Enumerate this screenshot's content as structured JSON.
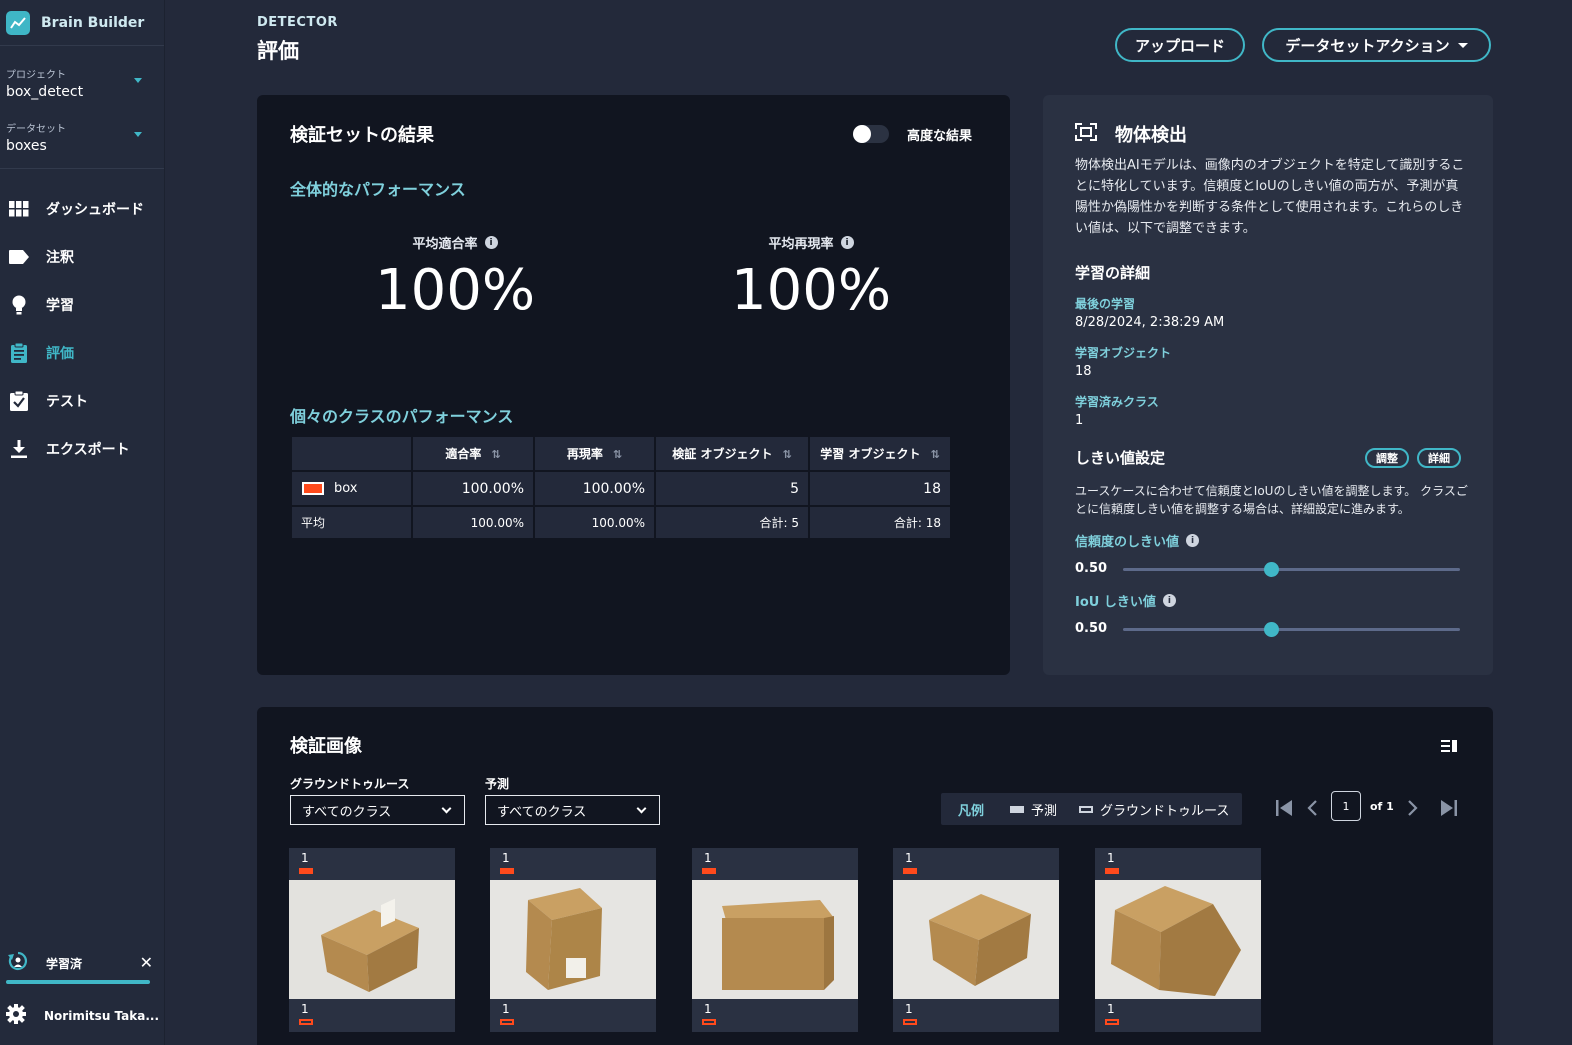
{
  "app": {
    "brand": "Brain Builder"
  },
  "sidebar": {
    "project": {
      "caption": "プロジェクト",
      "value": "box_detect"
    },
    "dataset": {
      "caption": "データセット",
      "value": "boxes"
    },
    "items": [
      {
        "label": "ダッシュボード",
        "icon": "grid-icon"
      },
      {
        "label": "注釈",
        "icon": "tag-icon"
      },
      {
        "label": "学習",
        "icon": "lightbulb-icon"
      },
      {
        "label": "評価",
        "icon": "clipboard-icon",
        "active": true
      },
      {
        "label": "テスト",
        "icon": "clipboard-check-icon"
      },
      {
        "label": "エクスポート",
        "icon": "download-icon"
      }
    ],
    "status": {
      "label": "学習済"
    },
    "user": {
      "name": "Norimitsu Taka..."
    }
  },
  "header": {
    "subtitle": "DETECTOR",
    "title": "評価",
    "upload_label": "アップロード",
    "dataset_action_label": "データセットアクション"
  },
  "results": {
    "title": "検証セットの結果",
    "advanced_toggle_label": "高度な結果",
    "overall_heading": "全体的なパフォーマンス",
    "precision_caption": "平均適合率",
    "precision_value": "100%",
    "recall_caption": "平均再現率",
    "recall_value": "100%",
    "class_heading": "個々のクラスのパフォーマンス",
    "table": {
      "headers": [
        "",
        "適合率",
        "再現率",
        "検証 オブジェクト",
        "学習 オブジェクト"
      ],
      "rows": [
        {
          "class": "box",
          "color": "#ff4a1c",
          "precision": "100.00%",
          "recall": "100.00%",
          "val_objects": "5",
          "train_objects": "18"
        }
      ],
      "average": {
        "label": "平均",
        "precision": "100.00%",
        "recall": "100.00%",
        "val_objects": "合計: 5",
        "train_objects": "合計: 18"
      }
    }
  },
  "detection": {
    "title": "物体検出",
    "description": "物体検出AIモデルは、画像内のオブジェクトを特定して識別することに特化しています。信頼度とIoUのしきい値の両方が、予測が真陽性か偽陽性かを判断する条件として使用されます。これらのしきい値は、以下で調整できます。",
    "training_heading": "学習の詳細",
    "last_training_label": "最後の学習",
    "last_training_value": "8/28/2024, 2:38:29 AM",
    "training_objects_label": "学習オブジェクト",
    "training_objects_value": "18",
    "trained_classes_label": "学習済みクラス",
    "trained_classes_value": "1",
    "threshold_heading": "しきい値設定",
    "adjust_label": "調整",
    "detail_label": "詳細",
    "threshold_description": "ユースケースに合わせて信頼度とIoUのしきい値を調整します。 クラスごとに信頼度しきい値を調整する場合は、詳細設定に進みます。",
    "confidence_label": "信頼度のしきい値",
    "confidence_value": "0.50",
    "iou_label": "IoU しきい値",
    "iou_value": "0.50"
  },
  "validation": {
    "title": "検証画像",
    "ground_truth_label": "グラウンドトゥルース",
    "ground_truth_value": "すべてのクラス",
    "prediction_label": "予測",
    "prediction_value": "すべてのクラス",
    "legend_title": "凡例",
    "legend_prediction": "予測",
    "legend_ground_truth": "グラウンドトゥルース",
    "page": "1",
    "page_of": "of 1",
    "images": [
      {
        "top_count": "1",
        "bottom_count": "1"
      },
      {
        "top_count": "1",
        "bottom_count": "1"
      },
      {
        "top_count": "1",
        "bottom_count": "1"
      },
      {
        "top_count": "1",
        "bottom_count": "1"
      },
      {
        "top_count": "1",
        "bottom_count": "1"
      }
    ]
  },
  "colors": {
    "accent": "#40b7c7",
    "box_class": "#ff4a1c",
    "panel": "#111520",
    "background": "#23293a"
  }
}
